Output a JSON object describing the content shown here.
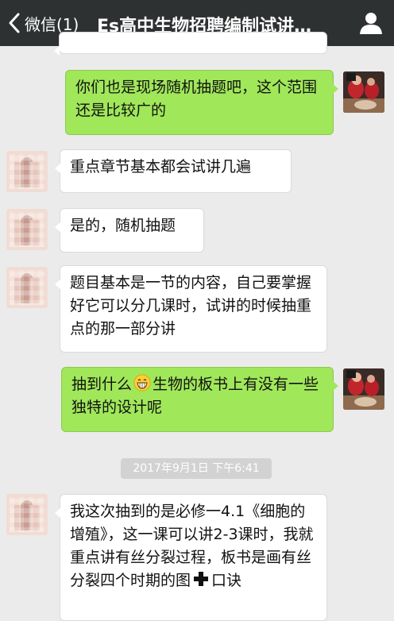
{
  "header": {
    "back_label": "微信(1)",
    "title": "Es高中生物招聘编制试讲…"
  },
  "messages": [
    {
      "sender": "self",
      "text": "你们也是现场随机抽题吧，这个范围还是比较广的"
    },
    {
      "sender": "other",
      "text": "重点章节基本都会试讲几遍"
    },
    {
      "sender": "other",
      "text": "是的，随机抽题"
    },
    {
      "sender": "other",
      "text": "题目基本是一节的内容，自己要掌握好它可以分几课时，试讲的时候抽重点的那一部分讲"
    },
    {
      "sender": "self",
      "text_before_emoji": "抽到什么",
      "emoji": "grinning-emoji",
      "text_after_emoji": "生物的板书上有没有一些独特的设计呢"
    },
    {
      "sender": "other",
      "text_before_icon": "我这次抽到的是必修一4.1《细胞的增殖》，这一课可以讲2-3课时，我就重点讲有丝分裂过程，板书是画有丝分裂四个时期的图",
      "icon": "plus-icon",
      "text_after_icon": "口诀"
    }
  ],
  "timestamp": "2017年9月1日 下午6:41",
  "colors": {
    "header": "#2e3132",
    "self_bubble": "#a0e75a",
    "other_bubble": "#ffffff",
    "background": "#ebebeb"
  }
}
